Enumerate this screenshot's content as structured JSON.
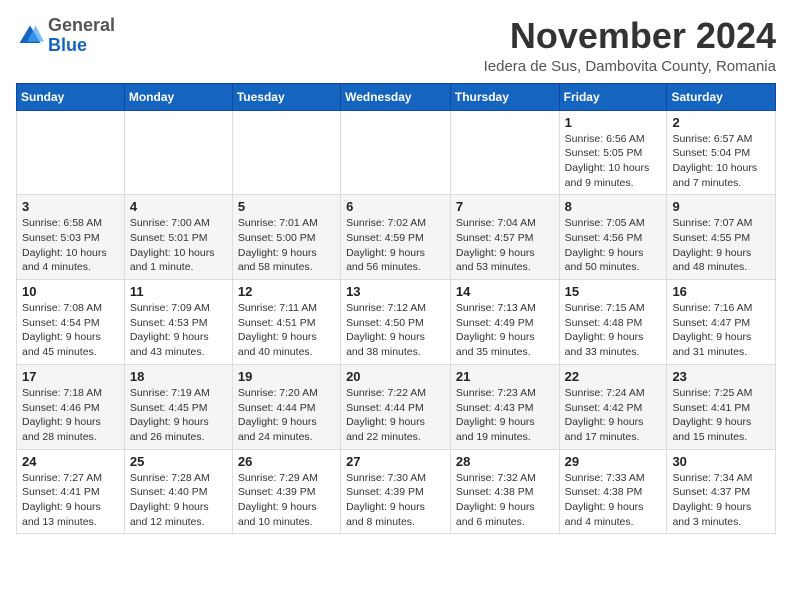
{
  "logo": {
    "general": "General",
    "blue": "Blue"
  },
  "header": {
    "month": "November 2024",
    "location": "Iedera de Sus, Dambovita County, Romania"
  },
  "weekdays": [
    "Sunday",
    "Monday",
    "Tuesday",
    "Wednesday",
    "Thursday",
    "Friday",
    "Saturday"
  ],
  "weeks": [
    [
      {
        "day": "",
        "info": ""
      },
      {
        "day": "",
        "info": ""
      },
      {
        "day": "",
        "info": ""
      },
      {
        "day": "",
        "info": ""
      },
      {
        "day": "",
        "info": ""
      },
      {
        "day": "1",
        "info": "Sunrise: 6:56 AM\nSunset: 5:05 PM\nDaylight: 10 hours and 9 minutes."
      },
      {
        "day": "2",
        "info": "Sunrise: 6:57 AM\nSunset: 5:04 PM\nDaylight: 10 hours and 7 minutes."
      }
    ],
    [
      {
        "day": "3",
        "info": "Sunrise: 6:58 AM\nSunset: 5:03 PM\nDaylight: 10 hours and 4 minutes."
      },
      {
        "day": "4",
        "info": "Sunrise: 7:00 AM\nSunset: 5:01 PM\nDaylight: 10 hours and 1 minute."
      },
      {
        "day": "5",
        "info": "Sunrise: 7:01 AM\nSunset: 5:00 PM\nDaylight: 9 hours and 58 minutes."
      },
      {
        "day": "6",
        "info": "Sunrise: 7:02 AM\nSunset: 4:59 PM\nDaylight: 9 hours and 56 minutes."
      },
      {
        "day": "7",
        "info": "Sunrise: 7:04 AM\nSunset: 4:57 PM\nDaylight: 9 hours and 53 minutes."
      },
      {
        "day": "8",
        "info": "Sunrise: 7:05 AM\nSunset: 4:56 PM\nDaylight: 9 hours and 50 minutes."
      },
      {
        "day": "9",
        "info": "Sunrise: 7:07 AM\nSunset: 4:55 PM\nDaylight: 9 hours and 48 minutes."
      }
    ],
    [
      {
        "day": "10",
        "info": "Sunrise: 7:08 AM\nSunset: 4:54 PM\nDaylight: 9 hours and 45 minutes."
      },
      {
        "day": "11",
        "info": "Sunrise: 7:09 AM\nSunset: 4:53 PM\nDaylight: 9 hours and 43 minutes."
      },
      {
        "day": "12",
        "info": "Sunrise: 7:11 AM\nSunset: 4:51 PM\nDaylight: 9 hours and 40 minutes."
      },
      {
        "day": "13",
        "info": "Sunrise: 7:12 AM\nSunset: 4:50 PM\nDaylight: 9 hours and 38 minutes."
      },
      {
        "day": "14",
        "info": "Sunrise: 7:13 AM\nSunset: 4:49 PM\nDaylight: 9 hours and 35 minutes."
      },
      {
        "day": "15",
        "info": "Sunrise: 7:15 AM\nSunset: 4:48 PM\nDaylight: 9 hours and 33 minutes."
      },
      {
        "day": "16",
        "info": "Sunrise: 7:16 AM\nSunset: 4:47 PM\nDaylight: 9 hours and 31 minutes."
      }
    ],
    [
      {
        "day": "17",
        "info": "Sunrise: 7:18 AM\nSunset: 4:46 PM\nDaylight: 9 hours and 28 minutes."
      },
      {
        "day": "18",
        "info": "Sunrise: 7:19 AM\nSunset: 4:45 PM\nDaylight: 9 hours and 26 minutes."
      },
      {
        "day": "19",
        "info": "Sunrise: 7:20 AM\nSunset: 4:44 PM\nDaylight: 9 hours and 24 minutes."
      },
      {
        "day": "20",
        "info": "Sunrise: 7:22 AM\nSunset: 4:44 PM\nDaylight: 9 hours and 22 minutes."
      },
      {
        "day": "21",
        "info": "Sunrise: 7:23 AM\nSunset: 4:43 PM\nDaylight: 9 hours and 19 minutes."
      },
      {
        "day": "22",
        "info": "Sunrise: 7:24 AM\nSunset: 4:42 PM\nDaylight: 9 hours and 17 minutes."
      },
      {
        "day": "23",
        "info": "Sunrise: 7:25 AM\nSunset: 4:41 PM\nDaylight: 9 hours and 15 minutes."
      }
    ],
    [
      {
        "day": "24",
        "info": "Sunrise: 7:27 AM\nSunset: 4:41 PM\nDaylight: 9 hours and 13 minutes."
      },
      {
        "day": "25",
        "info": "Sunrise: 7:28 AM\nSunset: 4:40 PM\nDaylight: 9 hours and 12 minutes."
      },
      {
        "day": "26",
        "info": "Sunrise: 7:29 AM\nSunset: 4:39 PM\nDaylight: 9 hours and 10 minutes."
      },
      {
        "day": "27",
        "info": "Sunrise: 7:30 AM\nSunset: 4:39 PM\nDaylight: 9 hours and 8 minutes."
      },
      {
        "day": "28",
        "info": "Sunrise: 7:32 AM\nSunset: 4:38 PM\nDaylight: 9 hours and 6 minutes."
      },
      {
        "day": "29",
        "info": "Sunrise: 7:33 AM\nSunset: 4:38 PM\nDaylight: 9 hours and 4 minutes."
      },
      {
        "day": "30",
        "info": "Sunrise: 7:34 AM\nSunset: 4:37 PM\nDaylight: 9 hours and 3 minutes."
      }
    ]
  ]
}
